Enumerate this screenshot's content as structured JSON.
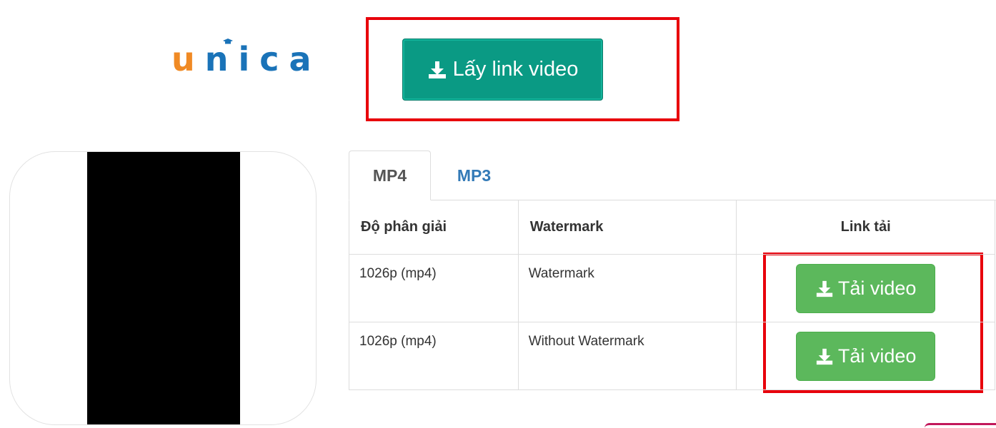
{
  "logo": {
    "first_letter": "u",
    "rest": "nica"
  },
  "header": {
    "get_link_label": "Lấy link video",
    "icon": "download-icon"
  },
  "tabs": [
    {
      "label": "MP4",
      "active": true
    },
    {
      "label": "MP3",
      "active": false
    }
  ],
  "table": {
    "headers": [
      "Độ phân giải",
      "Watermark",
      "Link tải"
    ],
    "rows": [
      {
        "resolution": "1026p (mp4)",
        "watermark": "Watermark",
        "button": "Tải video"
      },
      {
        "resolution": "1026p (mp4)",
        "watermark": "Without Watermark",
        "button": "Tải video"
      }
    ]
  },
  "colors": {
    "get_link_button": "#0a9a84",
    "download_button": "#5cb85c",
    "annotation_box": "#e8000b",
    "logo_orange": "#f08a24",
    "logo_blue": "#1a73b8"
  }
}
